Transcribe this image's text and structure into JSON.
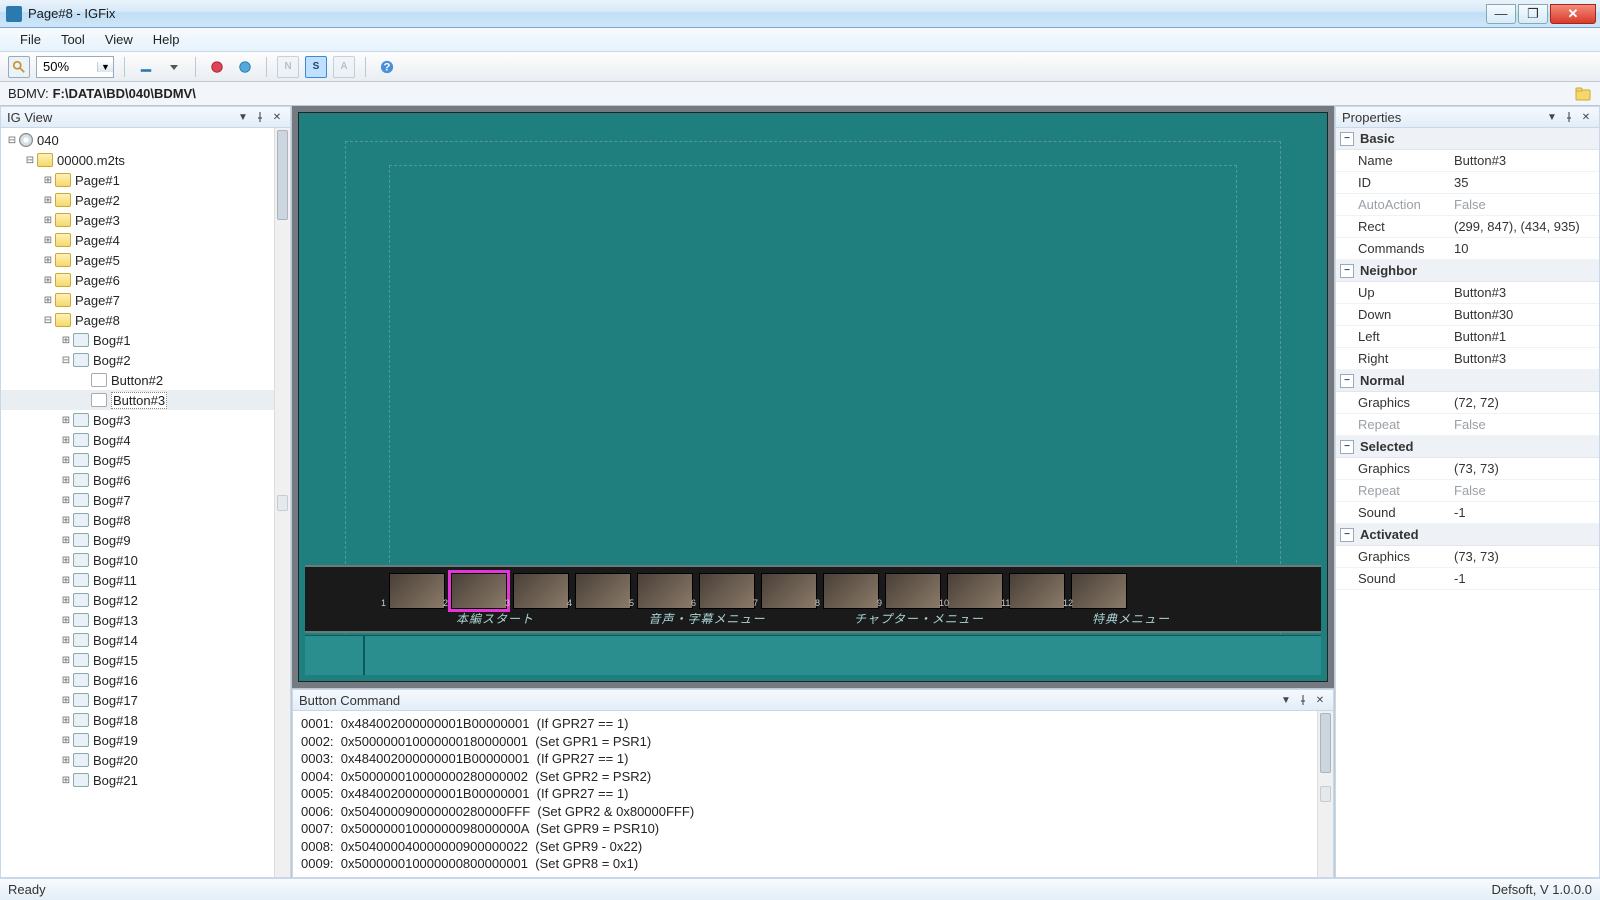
{
  "window": {
    "title": "Page#8 - IGFix"
  },
  "menu": {
    "file": "File",
    "tool": "Tool",
    "view": "View",
    "help": "Help"
  },
  "toolbar": {
    "zoom": "50%"
  },
  "pathbar": {
    "label": "BDMV:",
    "path": "F:\\DATA\\BD\\040\\BDMV\\"
  },
  "status": {
    "left": "Ready",
    "right": "Defsoft, V 1.0.0.0"
  },
  "igview": {
    "title": "IG View",
    "root": "040",
    "file": "00000.m2ts",
    "pages": [
      "Page#1",
      "Page#2",
      "Page#3",
      "Page#4",
      "Page#5",
      "Page#6",
      "Page#7",
      "Page#8"
    ],
    "page8": {
      "bogs_pre": [
        "Bog#1",
        "Bog#2"
      ],
      "bog2_buttons": [
        "Button#2",
        "Button#3"
      ],
      "bogs_post": [
        "Bog#3",
        "Bog#4",
        "Bog#5",
        "Bog#6",
        "Bog#7",
        "Bog#8",
        "Bog#9",
        "Bog#10",
        "Bog#11",
        "Bog#12",
        "Bog#13",
        "Bog#14",
        "Bog#15",
        "Bog#16",
        "Bog#17",
        "Bog#18",
        "Bog#19",
        "Bog#20",
        "Bog#21"
      ]
    }
  },
  "canvas": {
    "menu_labels": [
      "本編スタート",
      "音声・字幕メニュー",
      "チャプター・メニュー",
      "特典メニュー"
    ],
    "selected_thumb_index": 1,
    "thumb_count": 12
  },
  "buttoncmd": {
    "title": "Button Command",
    "lines": [
      "0001:  0x484002000000001B00000001  (If GPR27 == 1)",
      "0002:  0x500000010000000180000001  (Set GPR1 = PSR1)",
      "0003:  0x484002000000001B00000001  (If GPR27 == 1)",
      "0004:  0x500000010000000280000002  (Set GPR2 = PSR2)",
      "0005:  0x484002000000001B00000001  (If GPR27 == 1)",
      "0006:  0x504000090000000280000FFF  (Set GPR2 & 0x80000FFF)",
      "0007:  0x50000001000000098000000A  (Set GPR9 = PSR10)",
      "0008:  0x504000040000000900000022  (Set GPR9 - 0x22)",
      "0009:  0x500000010000000800000001  (Set GPR8 = 0x1)"
    ]
  },
  "properties": {
    "title": "Properties",
    "groups": [
      {
        "name": "Basic",
        "rows": [
          {
            "n": "Name",
            "v": "Button#3"
          },
          {
            "n": "ID",
            "v": "35"
          },
          {
            "n": "AutoAction",
            "v": "False",
            "dim": true
          },
          {
            "n": "Rect",
            "v": "(299, 847), (434, 935)"
          },
          {
            "n": "Commands",
            "v": "10"
          }
        ]
      },
      {
        "name": "Neighbor",
        "rows": [
          {
            "n": "Up",
            "v": "Button#3"
          },
          {
            "n": "Down",
            "v": "Button#30"
          },
          {
            "n": "Left",
            "v": "Button#1"
          },
          {
            "n": "Right",
            "v": "Button#3"
          }
        ]
      },
      {
        "name": "Normal",
        "rows": [
          {
            "n": "Graphics",
            "v": "(72, 72)"
          },
          {
            "n": "Repeat",
            "v": "False",
            "dim": true
          }
        ]
      },
      {
        "name": "Selected",
        "rows": [
          {
            "n": "Graphics",
            "v": "(73, 73)"
          },
          {
            "n": "Repeat",
            "v": "False",
            "dim": true
          },
          {
            "n": "Sound",
            "v": "-1"
          }
        ]
      },
      {
        "name": "Activated",
        "rows": [
          {
            "n": "Graphics",
            "v": "(73, 73)"
          },
          {
            "n": "Sound",
            "v": "-1"
          }
        ]
      }
    ]
  }
}
